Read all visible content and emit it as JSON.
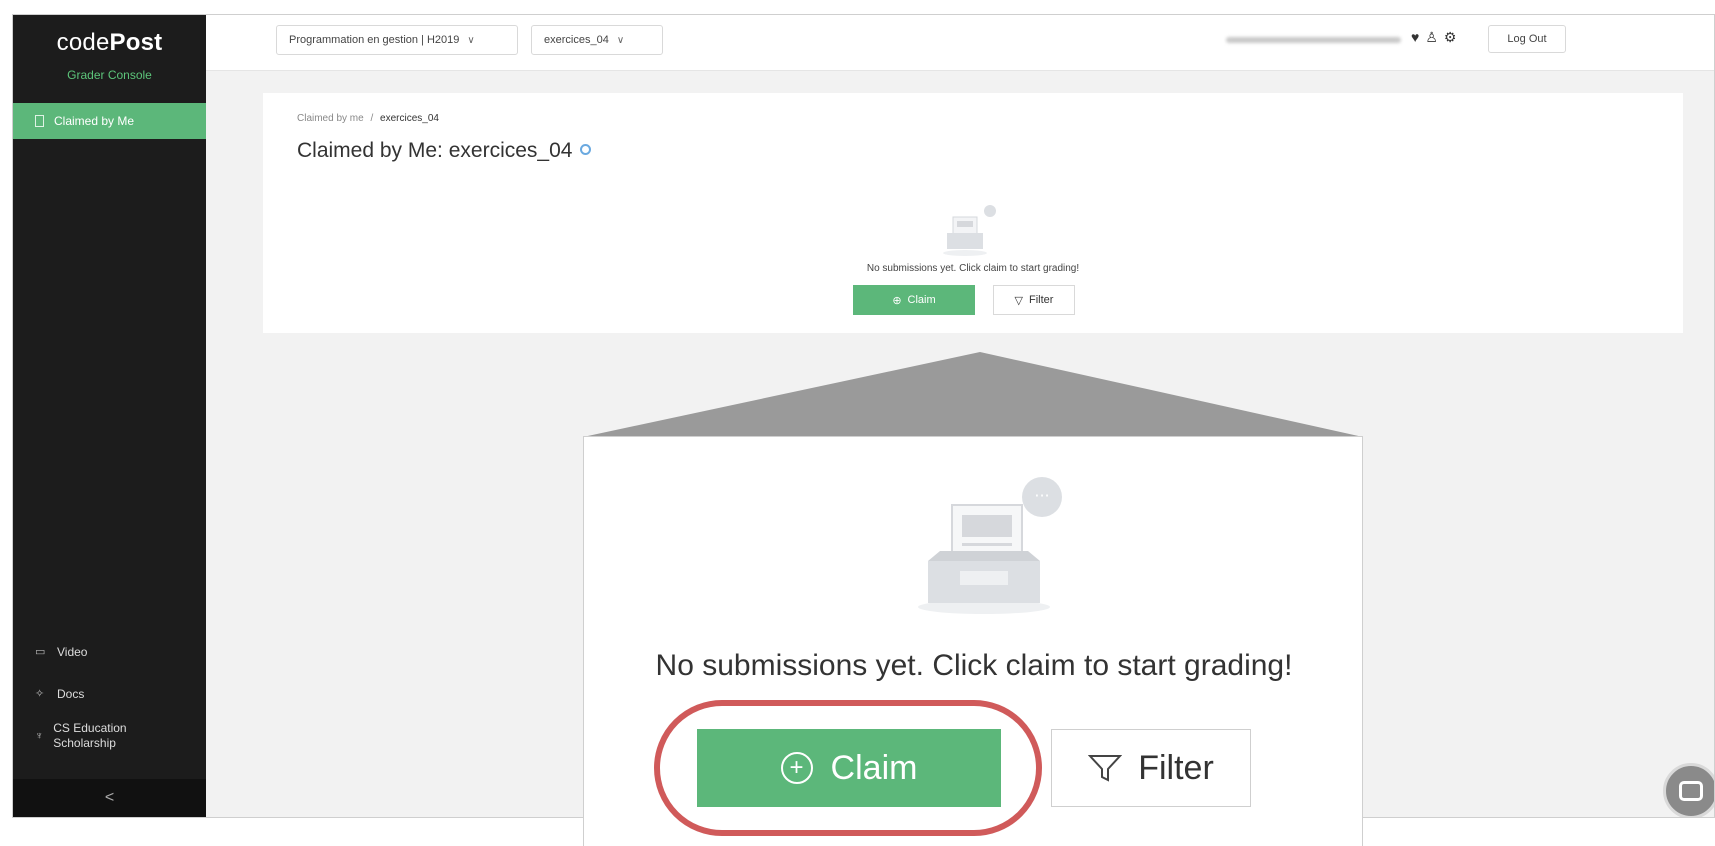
{
  "sidebar": {
    "brand_light": "code",
    "brand_bold": "Post",
    "subtitle": "Grader Console",
    "active_item": "Claimed by Me",
    "bottom_items": [
      {
        "label": "Video",
        "icon": "video-icon"
      },
      {
        "label": "Docs",
        "icon": "pin-icon"
      },
      {
        "label": "CS Education Scholarship",
        "icon": "trophy-icon"
      }
    ],
    "collapse_glyph": "<"
  },
  "header": {
    "course_select": "Programmation en gestion | H2019",
    "assignment_select": "exercices_04",
    "logout_label": "Log Out"
  },
  "content": {
    "breadcrumb_root": "Claimed by me",
    "breadcrumb_sep": "/",
    "breadcrumb_current": "exercices_04",
    "page_title": "Claimed by Me: exercices_04",
    "empty_message": "No submissions yet. Click claim to start grading!",
    "claim_label": "Claim",
    "filter_label": "Filter"
  },
  "zoom": {
    "empty_message": "No submissions yet. Click claim to start grading!",
    "claim_label": "Claim",
    "filter_label": "Filter",
    "highlight_color": "#d05a5a"
  },
  "colors": {
    "accent": "#5cb77a",
    "sidebar_bg": "#1c1c1c"
  }
}
